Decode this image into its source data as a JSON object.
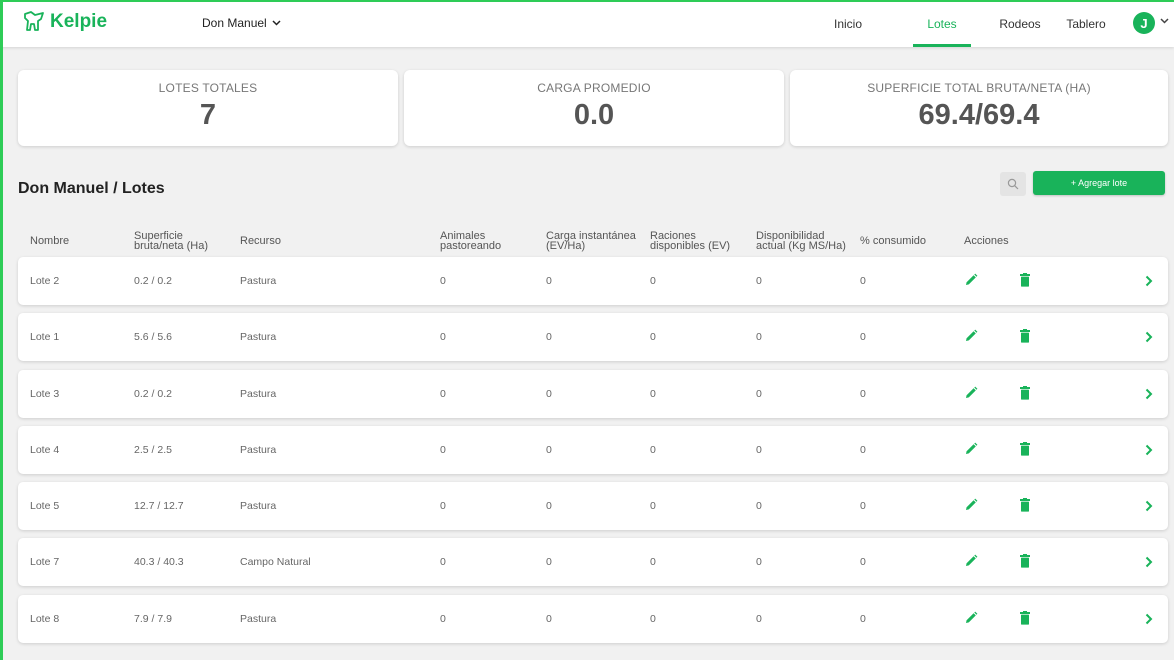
{
  "brand": {
    "name": "Kelpie",
    "color": "#19b35a"
  },
  "header": {
    "establishment": "Don Manuel",
    "nav": [
      {
        "label": "Inicio",
        "active": false
      },
      {
        "label": "Lotes",
        "active": true
      },
      {
        "label": "Rodeos",
        "active": false
      },
      {
        "label": "Tablero",
        "active": false
      }
    ],
    "avatar_initial": "J"
  },
  "stats": [
    {
      "label": "LOTES TOTALES",
      "value": "7"
    },
    {
      "label": "CARGA PROMEDIO",
      "value": "0.0"
    },
    {
      "label": "SUPERFICIE TOTAL BRUTA/NETA (HA)",
      "value": "69.4/69.4"
    }
  ],
  "page": {
    "title": "Don Manuel / Lotes",
    "add_button": "+ Agregar lote",
    "search_icon": "magnifier-icon"
  },
  "table": {
    "columns": [
      "Nombre",
      "Superficie bruta/neta (Ha)",
      "Recurso",
      "Animales pastoreando",
      "Carga instantánea (EV/Ha)",
      "Raciones disponibles (EV)",
      "Disponibilidad actual (Kg MS/Ha)",
      "% consumido",
      "Acciones"
    ],
    "rows": [
      {
        "nombre": "Lote 2",
        "superficie": "0.2 / 0.2",
        "recurso": "Pastura",
        "animales": "0",
        "carga": "0",
        "raciones": "0",
        "disponibilidad": "0",
        "consumido": "0"
      },
      {
        "nombre": "Lote 1",
        "superficie": "5.6 / 5.6",
        "recurso": "Pastura",
        "animales": "0",
        "carga": "0",
        "raciones": "0",
        "disponibilidad": "0",
        "consumido": "0"
      },
      {
        "nombre": "Lote 3",
        "superficie": "0.2 / 0.2",
        "recurso": "Pastura",
        "animales": "0",
        "carga": "0",
        "raciones": "0",
        "disponibilidad": "0",
        "consumido": "0"
      },
      {
        "nombre": "Lote 4",
        "superficie": "2.5 / 2.5",
        "recurso": "Pastura",
        "animales": "0",
        "carga": "0",
        "raciones": "0",
        "disponibilidad": "0",
        "consumido": "0"
      },
      {
        "nombre": "Lote 5",
        "superficie": "12.7 / 12.7",
        "recurso": "Pastura",
        "animales": "0",
        "carga": "0",
        "raciones": "0",
        "disponibilidad": "0",
        "consumido": "0"
      },
      {
        "nombre": "Lote 7",
        "superficie": "40.3 / 40.3",
        "recurso": "Campo Natural",
        "animales": "0",
        "carga": "0",
        "raciones": "0",
        "disponibilidad": "0",
        "consumido": "0"
      },
      {
        "nombre": "Lote 8",
        "superficie": "7.9 / 7.9",
        "recurso": "Pastura",
        "animales": "0",
        "carga": "0",
        "raciones": "0",
        "disponibilidad": "0",
        "consumido": "0"
      }
    ],
    "row_actions": [
      "pencil-edit-icon",
      "trash-delete-icon",
      "chevron-right-icon"
    ]
  }
}
